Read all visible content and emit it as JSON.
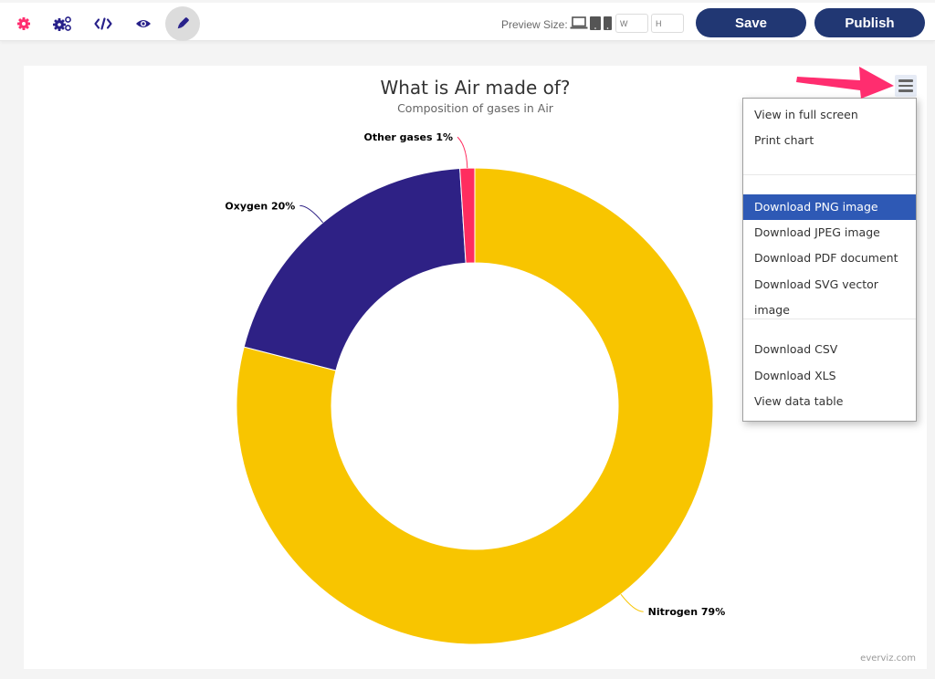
{
  "toolbar": {
    "icons": [
      {
        "name": "settings-icon",
        "color": "#ff2d6f"
      },
      {
        "name": "advanced-settings-icon",
        "color": "#28218a"
      },
      {
        "name": "code-icon",
        "color": "#28218a"
      },
      {
        "name": "preview-icon",
        "color": "#28218a"
      },
      {
        "name": "customize-icon",
        "color": "#28218a"
      }
    ],
    "preview_label": "Preview Size:",
    "width_placeholder": "W",
    "height_placeholder": "H",
    "save_label": "Save",
    "publish_label": "Publish",
    "button_color": "#213773"
  },
  "context_menu": {
    "items": [
      {
        "label": "View in full screen"
      },
      {
        "label": "Print chart"
      },
      {
        "label": "Download PNG image",
        "highlighted": true
      },
      {
        "label": "Download JPEG image"
      },
      {
        "label": "Download PDF document"
      },
      {
        "label": "Download SVG vector image"
      },
      {
        "label": "Download CSV"
      },
      {
        "label": "Download XLS"
      },
      {
        "label": "View data table"
      }
    ],
    "highlight_color": "#2e59b5"
  },
  "annotation": {
    "arrow_color": "#ff2d6f"
  },
  "credits": "everviz.com",
  "chart_data": {
    "type": "pie",
    "variant": "donut",
    "title": "What is Air made of?",
    "subtitle": "Composition of gases in Air",
    "start_angle_deg": 0,
    "series": [
      {
        "name": "Nitrogen",
        "value": 79,
        "label": "Nitrogen 79%",
        "color": "#f8c500"
      },
      {
        "name": "Oxygen",
        "value": 20,
        "label": "Oxygen 20%",
        "color": "#2e2185"
      },
      {
        "name": "Other gases",
        "value": 1,
        "label": "Other gases 1%",
        "color": "#ff2d5f"
      }
    ],
    "legend": "none",
    "data_labels": true
  }
}
